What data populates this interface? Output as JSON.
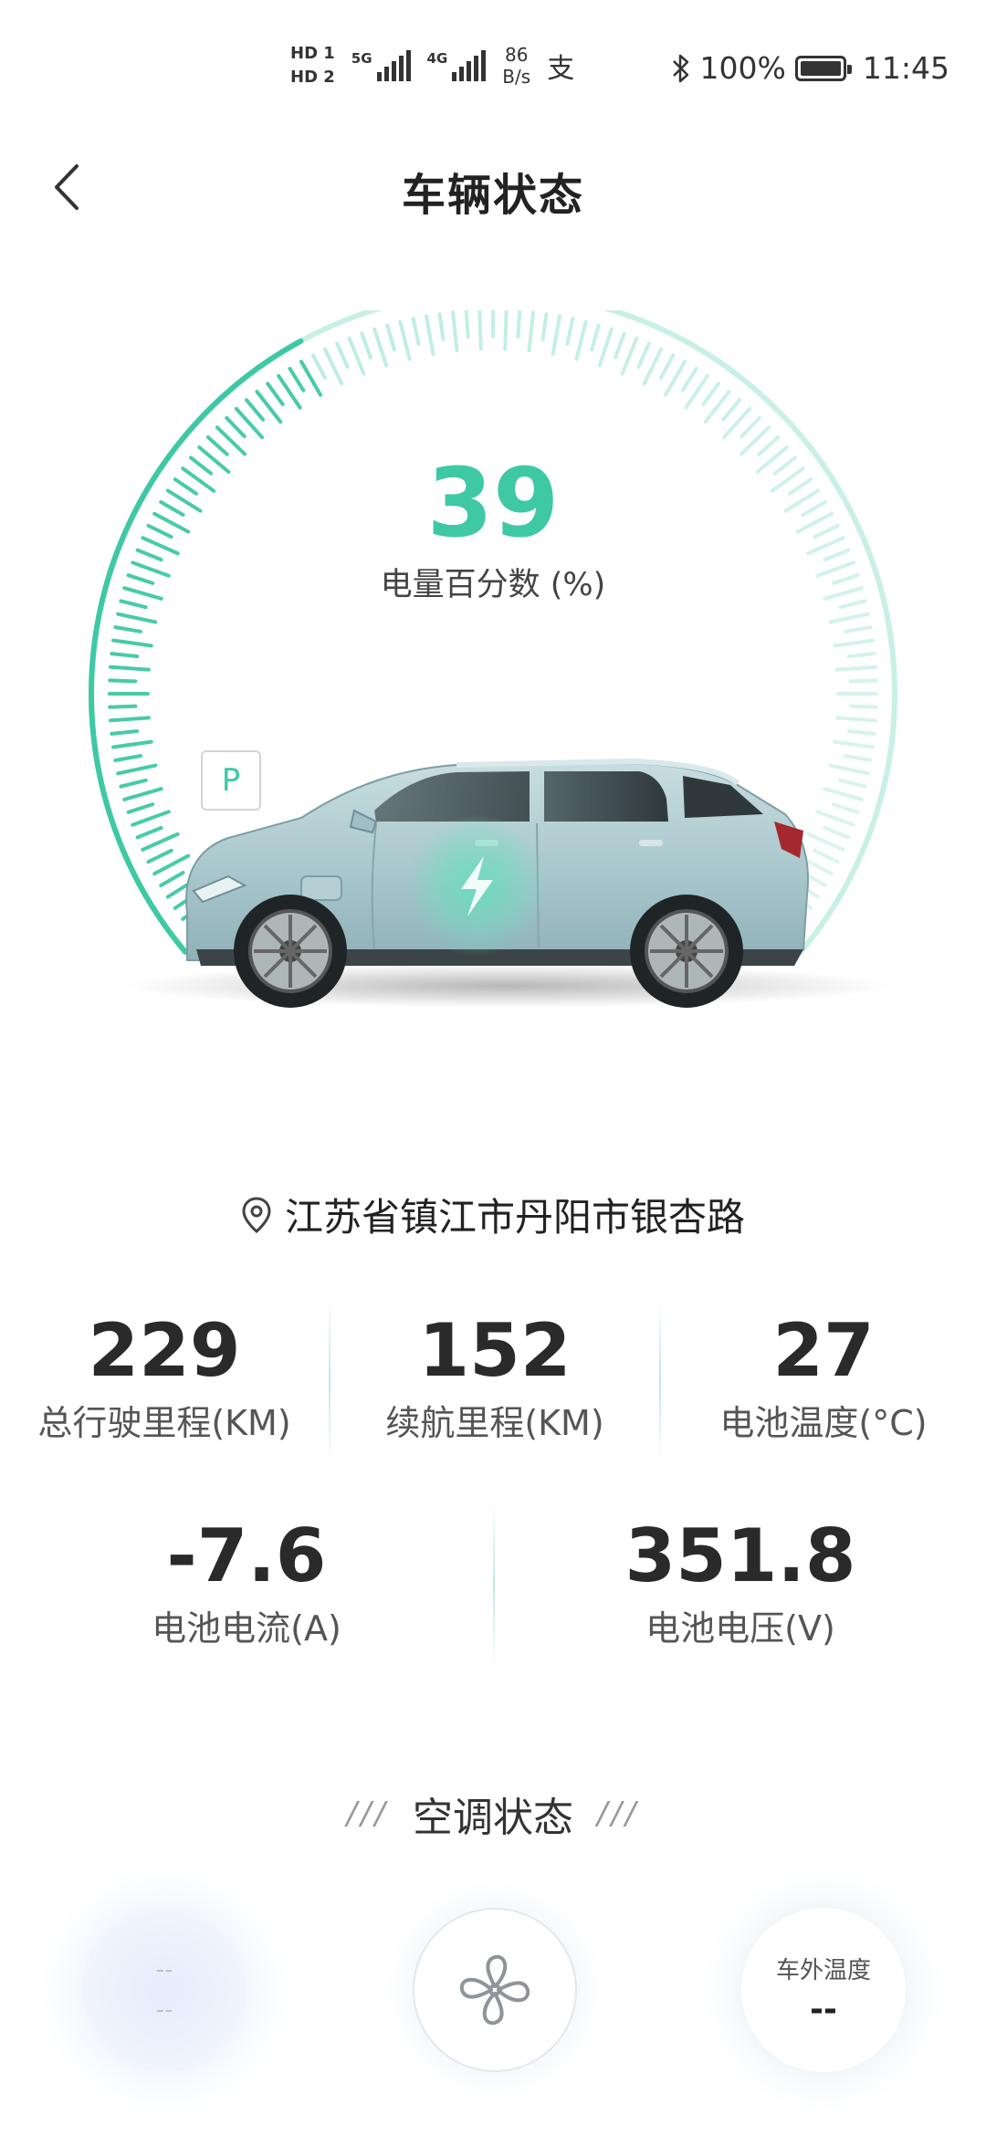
{
  "status_bar": {
    "hd1": "HD 1",
    "hd2": "HD 2",
    "net1": "5G",
    "net2": "4G",
    "speed_value": "86",
    "speed_unit": "B/s",
    "pay_icon": "alipay-icon",
    "bluetooth_icon": "bluetooth-icon",
    "battery_percent": "100%",
    "time": "11:45"
  },
  "header": {
    "title": "车辆状态",
    "back_icon": "chevron-left-icon"
  },
  "gauge": {
    "value": "39",
    "value_fraction": 0.39,
    "label": "电量百分数 (%)",
    "gear": "P",
    "accent_color": "#3ec9a4"
  },
  "location": {
    "icon": "location-pin-icon",
    "text": "江苏省镇江市丹阳市银杏路"
  },
  "stats": [
    {
      "value": "229",
      "label": "总行驶里程(KM)"
    },
    {
      "value": "152",
      "label": "续航里程(KM)"
    },
    {
      "value": "27",
      "label": "电池温度(°C)"
    },
    {
      "value": "-7.6",
      "label": "电池电流(A)"
    },
    {
      "value": "351.8",
      "label": "电池电压(V)"
    }
  ],
  "ac": {
    "title": "空调状态",
    "slashes": "///",
    "cabin_temp_top": "--",
    "cabin_temp_bottom": "--",
    "fan_icon": "fan-icon",
    "outside_label": "车外温度",
    "outside_value": "--"
  }
}
